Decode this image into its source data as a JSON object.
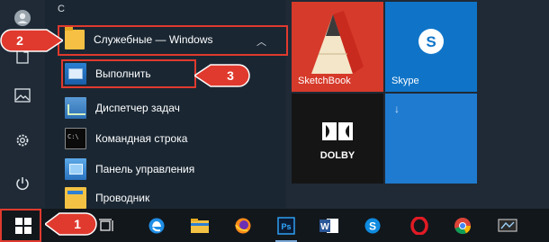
{
  "start_menu": {
    "letter_header": "C",
    "folder": {
      "label": "Служебные — Windows",
      "folder_color": "#f5c043"
    },
    "apps": [
      {
        "label": "Выполнить",
        "icon": "run-icon"
      },
      {
        "label": "Диспетчер задач",
        "icon": "task-manager-icon"
      },
      {
        "label": "Командная строка",
        "icon": "command-prompt-icon"
      },
      {
        "label": "Панель управления",
        "icon": "control-panel-icon"
      },
      {
        "label": "Проводник",
        "icon": "explorer-icon"
      }
    ],
    "rail_icons": [
      "user-icon",
      "document-icon",
      "pictures-icon",
      "settings-icon",
      "power-icon"
    ]
  },
  "tiles": {
    "sketchbook": {
      "label": "SketchBook",
      "color": "#d63a2a"
    },
    "skype": {
      "label": "Skype",
      "color": "#0f74c8"
    },
    "dolby": {
      "label": "",
      "logo_text": "DOLBY",
      "color": "#151515"
    },
    "download": {
      "arrow": "↓",
      "color": "#1f7bd0"
    }
  },
  "taskbar": {
    "items": [
      "start-button",
      "task-view-icon",
      "edge-icon",
      "file-explorer-icon",
      "firefox-icon",
      "photoshop-icon",
      "word-icon",
      "skype-icon",
      "opera-icon",
      "chrome-icon",
      "slides-icon"
    ]
  },
  "annotations": {
    "step1": "1",
    "step2": "2",
    "step3": "3",
    "color": "#e03a2e"
  }
}
